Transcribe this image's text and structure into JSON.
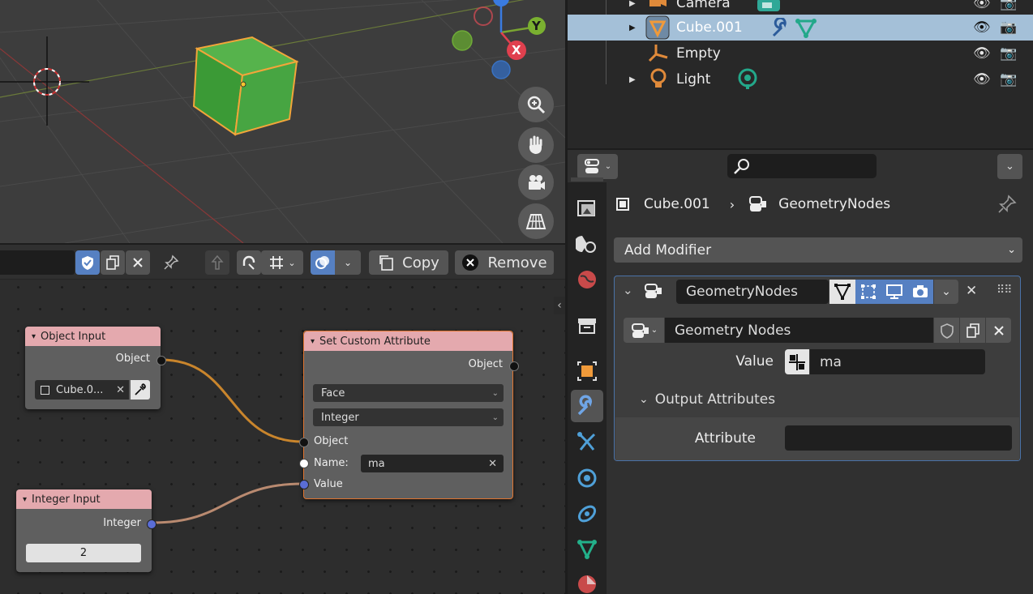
{
  "outliner": {
    "rows": [
      {
        "label": "Camera"
      },
      {
        "label": "Cube.001"
      },
      {
        "label": "Empty"
      },
      {
        "label": "Light"
      }
    ]
  },
  "node_editor": {
    "header": {
      "copy_label": "Copy",
      "remove_label": "Remove"
    },
    "object_input_node": {
      "title": "Object Input",
      "output_label": "Object",
      "object_value": "Cube.0..."
    },
    "set_attribute_node": {
      "title": "Set Custom Attribute",
      "output_label": "Object",
      "domain_value": "Face",
      "type_value": "Integer",
      "object_socket_label": "Object",
      "name_label": "Name:",
      "name_value": "ma",
      "value_label": "Value"
    },
    "integer_input_node": {
      "title": "Integer Input",
      "output_label": "Integer",
      "value": "2"
    }
  },
  "viewport": {
    "gizmo_y": "Y",
    "gizmo_x": "X"
  },
  "properties": {
    "breadcrumb": {
      "object": "Cube.001",
      "modifier": "GeometryNodes"
    },
    "add_modifier_label": "Add Modifier",
    "modifier": {
      "name": "GeometryNodes",
      "node_group": "Geometry Nodes",
      "value_label": "Value",
      "value": "ma",
      "output_attributes_label": "Output Attributes",
      "attribute_label": "Attribute",
      "attribute_value": ""
    }
  },
  "colors": {
    "node_header": "#e4a9ae",
    "selection_row": "#a4c0d8",
    "toggle_blue": "#5680c2",
    "cube_green": "#44a83f",
    "object_socket": "#000000",
    "int_socket": "#5a6dd6",
    "link_orange": "#c9852c"
  }
}
